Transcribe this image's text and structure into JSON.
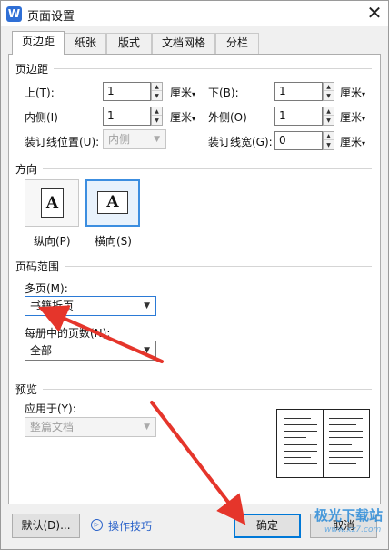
{
  "window": {
    "title": "页面设置",
    "app_icon_letter": "W",
    "close_glyph": "✕"
  },
  "tabs": [
    {
      "label": "页边距",
      "active": true
    },
    {
      "label": "纸张"
    },
    {
      "label": "版式"
    },
    {
      "label": "文档网格"
    },
    {
      "label": "分栏"
    }
  ],
  "margins": {
    "group_title": "页边距",
    "top": {
      "label": "上(T):",
      "value": "1",
      "unit": "厘米"
    },
    "bottom": {
      "label": "下(B):",
      "value": "1",
      "unit": "厘米"
    },
    "inside": {
      "label": "内侧(I)",
      "value": "1",
      "unit": "厘米"
    },
    "outside": {
      "label": "外侧(O)",
      "value": "1",
      "unit": "厘米"
    },
    "gutter_pos": {
      "label": "装订线位置(U):",
      "value": "内侧"
    },
    "gutter_width": {
      "label": "装订线宽(G):",
      "value": "0",
      "unit": "厘米"
    }
  },
  "orientation": {
    "group_title": "方向",
    "portrait": {
      "label": "纵向(P)",
      "glyph": "A"
    },
    "landscape": {
      "label": "横向(S)",
      "glyph": "A",
      "selected": true
    }
  },
  "page_range": {
    "group_title": "页码范围",
    "multi_label": "多页(M):",
    "multi_value": "书籍折页",
    "per_book_label": "每册中的页数(N):",
    "per_book_value": "全部"
  },
  "preview": {
    "group_title": "预览",
    "apply_label": "应用于(Y):",
    "apply_value": "整篇文档"
  },
  "footer": {
    "default_button": "默认(D)...",
    "tips_link": "操作技巧",
    "ok_button": "确定",
    "cancel_button": "取消"
  },
  "icons": {
    "dropdown": "▼",
    "unit_caret": "▾",
    "spin_up": "▲",
    "spin_down": "▼",
    "tips_icon": "▷"
  },
  "watermark": {
    "text": "极光下载站",
    "sub": "www.xz7.com"
  },
  "colors": {
    "selection_border": "#3c8ee0",
    "annotation_arrow": "#e5352b",
    "link": "#2a62c9"
  }
}
